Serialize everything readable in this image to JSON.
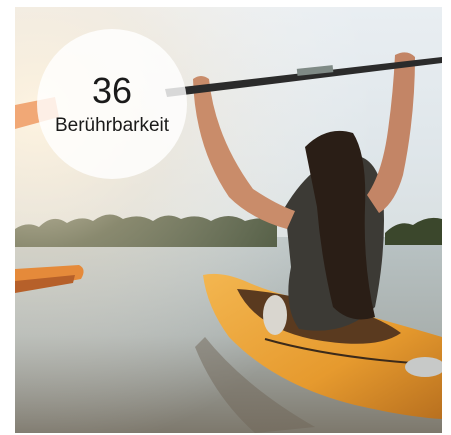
{
  "stat": {
    "value": "36",
    "label": "Berührbarkeit"
  },
  "photo": {
    "subject": "kayak-paddler-icon"
  }
}
